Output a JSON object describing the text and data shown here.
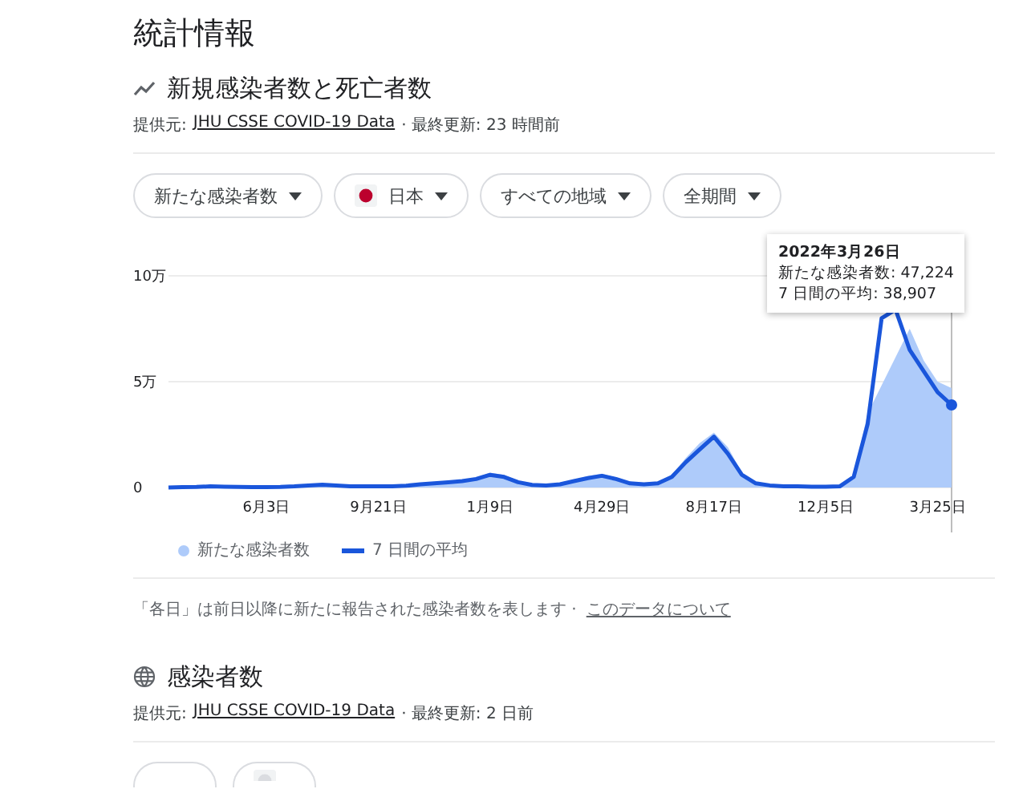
{
  "title": "統計情報",
  "section1": {
    "heading": "新規感染者数と死亡者数",
    "source_label": "提供元:",
    "source_link": "JHU CSSE COVID-19 Data",
    "updated": "· 最終更新: 23 時間前",
    "filters": [
      {
        "label": "新たな感染者数",
        "kind": "plain"
      },
      {
        "label": "日本",
        "kind": "flag"
      },
      {
        "label": "すべての地域",
        "kind": "plain"
      },
      {
        "label": "全期間",
        "kind": "plain"
      }
    ],
    "chart_data": {
      "type": "area",
      "categories": [
        null,
        null,
        null,
        null,
        null,
        null,
        null,
        "6月3日",
        null,
        null,
        null,
        null,
        null,
        null,
        null,
        "9月21日",
        null,
        null,
        null,
        null,
        null,
        null,
        null,
        "1月9日",
        null,
        null,
        null,
        null,
        null,
        null,
        null,
        "4月29日",
        null,
        null,
        null,
        null,
        null,
        null,
        null,
        "8月17日",
        null,
        null,
        null,
        null,
        null,
        null,
        null,
        "12月5日",
        null,
        null,
        null,
        null,
        null,
        null,
        null,
        "3月25日",
        null
      ],
      "series": [
        {
          "name": "新たな感染者数",
          "type": "area",
          "color": "#aecbfa",
          "values": [
            0,
            0.03,
            0.04,
            0.06,
            0.05,
            0.04,
            0.03,
            0.03,
            0.04,
            0.06,
            0.12,
            0.16,
            0.12,
            0.07,
            0.06,
            0.06,
            0.07,
            0.1,
            0.18,
            0.24,
            0.3,
            0.36,
            0.48,
            0.7,
            0.6,
            0.3,
            0.14,
            0.12,
            0.18,
            0.36,
            0.54,
            0.65,
            0.48,
            0.24,
            0.18,
            0.24,
            0.6,
            1.4,
            2.1,
            2.6,
            1.9,
            0.7,
            0.24,
            0.12,
            0.07,
            0.06,
            0.05,
            0.05,
            0.06,
            0.6,
            3.5,
            null,
            null,
            7.5,
            6.0,
            5.0,
            4.7
          ]
        },
        {
          "name": "7 日間の平均",
          "type": "line",
          "color": "#1a56db",
          "values": [
            0,
            0.02,
            0.03,
            0.05,
            0.04,
            0.03,
            0.02,
            0.02,
            0.03,
            0.05,
            0.1,
            0.14,
            0.1,
            0.06,
            0.05,
            0.05,
            0.06,
            0.08,
            0.15,
            0.2,
            0.25,
            0.3,
            0.4,
            0.6,
            0.5,
            0.25,
            0.12,
            0.1,
            0.15,
            0.3,
            0.45,
            0.55,
            0.4,
            0.2,
            0.15,
            0.2,
            0.5,
            1.2,
            1.8,
            2.4,
            1.6,
            0.6,
            0.2,
            0.1,
            0.06,
            0.05,
            0.04,
            0.04,
            0.05,
            0.5,
            3.0,
            8.0,
            8.4,
            6.5,
            5.5,
            4.5,
            3.9
          ]
        }
      ],
      "ylim": [
        0,
        10
      ],
      "yticks": [
        {
          "value": 0,
          "label": "0"
        },
        {
          "value": 5,
          "label": "5万"
        },
        {
          "value": 10,
          "label": "10万"
        }
      ]
    },
    "tooltip": {
      "title": "2022年3月26日",
      "lines": [
        "新たな感染者数: 47,224",
        "7 日間の平均: 38,907"
      ]
    },
    "note": "「各日」は前日以降に新たに報告された感染者数を表します ·",
    "note_link": "このデータについて"
  },
  "section2": {
    "heading": "感染者数",
    "source_label": "提供元:",
    "source_link": "JHU CSSE COVID-19 Data",
    "updated": "· 最終更新: 2 日前",
    "filters": [
      {
        "kind": "plain"
      },
      {
        "kind": "flag"
      }
    ]
  }
}
